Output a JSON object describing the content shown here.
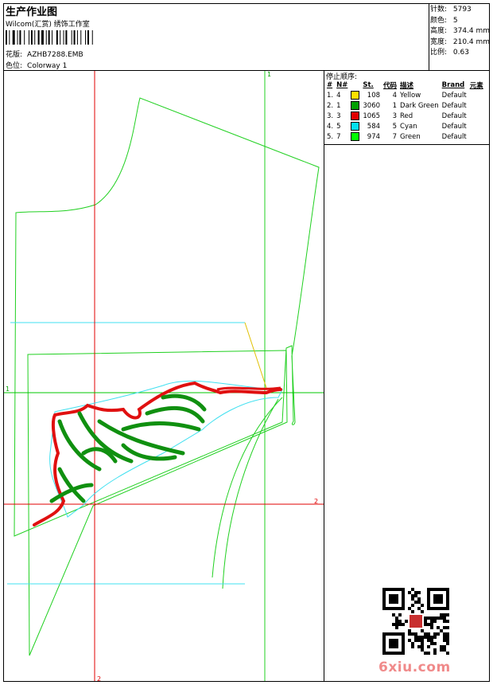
{
  "header": {
    "title": "生产作业图",
    "company": "Wilcom(汇赏) 绣饰工作室",
    "design_label": "花版:",
    "design_value": "AZHB7288.EMB",
    "colorway_label": "色位:",
    "colorway_value": "Colorway 1"
  },
  "stats": {
    "stitches_label": "针数:",
    "stitches_value": "5793",
    "colors_label": "颜色:",
    "colors_value": "5",
    "height_label": "高度:",
    "height_value": "374.4 mm",
    "width_label": "宽度:",
    "width_value": "210.4 mm",
    "scale_label": "比例:",
    "scale_value": "0.63"
  },
  "stop_sequence": {
    "title": "停止顺序:",
    "headers": [
      "#",
      "N#",
      "St.",
      "代码",
      "描述",
      "Brand",
      "元素"
    ],
    "rows": [
      {
        "num": "1.",
        "n": "4",
        "color": "#ffe000",
        "st": "108",
        "code": "4",
        "desc": "Yellow",
        "brand": "Default"
      },
      {
        "num": "2.",
        "n": "1",
        "color": "#00a000",
        "st": "3060",
        "code": "1",
        "desc": "Dark Green",
        "brand": "Default"
      },
      {
        "num": "3.",
        "n": "3",
        "color": "#e00000",
        "st": "1065",
        "code": "3",
        "desc": "Red",
        "brand": "Default"
      },
      {
        "num": "4.",
        "n": "5",
        "color": "#00e0f0",
        "st": "584",
        "code": "5",
        "desc": "Cyan",
        "brand": "Default"
      },
      {
        "num": "5.",
        "n": "7",
        "color": "#00ff00",
        "st": "974",
        "code": "7",
        "desc": "Green",
        "brand": "Default"
      }
    ]
  },
  "axes": {
    "h1": "1",
    "h2": "2",
    "v1": "1",
    "v2": "2"
  },
  "watermark": "6xiu.com",
  "colors": {
    "red_axis": "#e00000",
    "green_axis": "#00c800",
    "outline_green": "#20d020",
    "cyan": "#40e0f0",
    "dark_green": "#109010",
    "red": "#e01010",
    "yellow": "#e0c000"
  }
}
